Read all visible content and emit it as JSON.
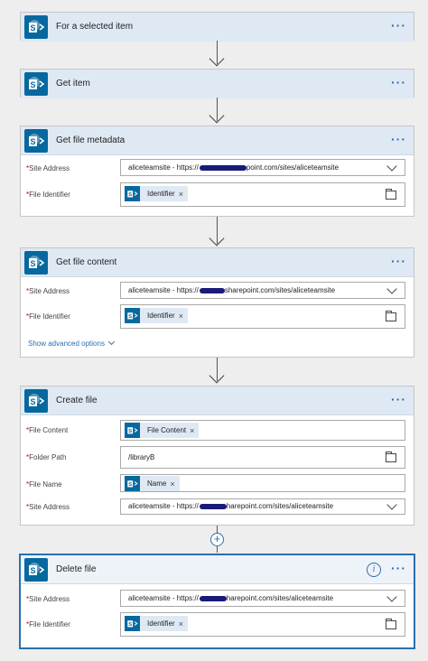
{
  "steps": {
    "trigger": {
      "title": "For a selected item",
      "menu": "···"
    },
    "get_item": {
      "title": "Get item",
      "menu": "···"
    },
    "get_metadata": {
      "title": "Get file metadata",
      "menu": "···",
      "site_label": "Site Address",
      "site_pre": "aliceteamsite - https://",
      "site_post": "point.com/sites/aliceteamsite",
      "fileid_label": "File Identifier",
      "fileid_token": "Identifier"
    },
    "get_content": {
      "title": "Get file content",
      "menu": "···",
      "site_label": "Site Address",
      "site_pre": "aliceteamsite - https://",
      "site_post": "sharepoint.com/sites/aliceteamsite",
      "fileid_label": "File Identifier",
      "fileid_token": "Identifier",
      "advanced": "Show advanced options"
    },
    "create_file": {
      "title": "Create file",
      "menu": "···",
      "content_label": "File Content",
      "content_token": "File Content",
      "folder_label": "Folder Path",
      "folder_value": "/libraryB",
      "name_label": "File Name",
      "name_token": "Name",
      "site_label": "Site Address",
      "site_pre": "aliceteamsite - https://",
      "site_post": "harepoint.com/sites/aliceteamsite"
    },
    "delete_file": {
      "title": "Delete file",
      "menu": "···",
      "info": "i",
      "site_label": "Site Address",
      "site_pre": "aliceteamsite - https://",
      "site_post": "harepoint.com/sites/aliceteamsite",
      "fileid_label": "File Identifier",
      "fileid_token": "Identifier"
    }
  },
  "glyphs": {
    "required": "*",
    "remove": "×",
    "add": "+"
  },
  "colors": {
    "sharepoint": "#07689f",
    "accent": "#2a6fb2",
    "header": "#dfe9f4",
    "required": "#cc0000"
  }
}
